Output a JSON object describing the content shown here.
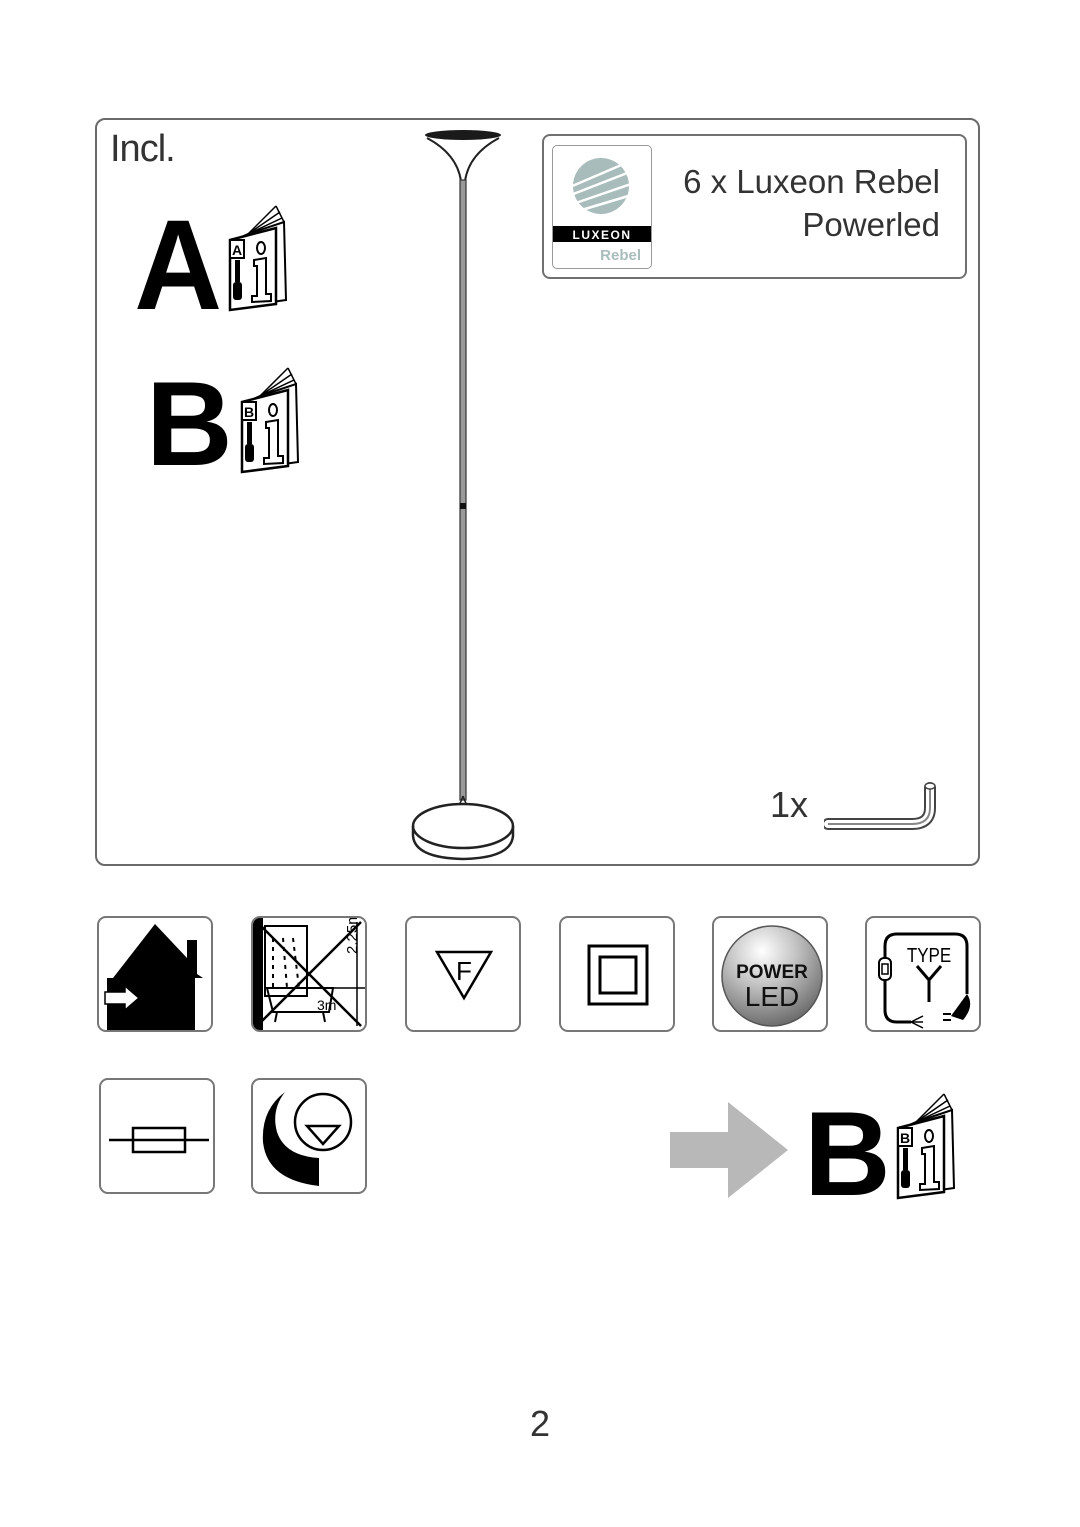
{
  "included_section": {
    "title": "Incl.",
    "manuals": [
      {
        "letter": "A",
        "icon": "manual-booklet-icon",
        "booklet_label": "A"
      },
      {
        "letter": "B",
        "icon": "manual-booklet-icon",
        "booklet_label": "B"
      }
    ],
    "product_illustration": "floor-lamp-uplighter",
    "led_info": {
      "logo_brand": "LUXEON",
      "logo_sub": "Rebel",
      "line1": "6 x Luxeon Rebel",
      "line2": "Powerled"
    },
    "accessory": {
      "quantity": "1x",
      "icon": "allen-key-icon"
    }
  },
  "symbols_row1": [
    {
      "name": "indoor-use-only-icon"
    },
    {
      "name": "no-bathroom-use-icon",
      "dim_height": "2.25m",
      "dim_distance": "3m"
    },
    {
      "name": "f-mark-icon",
      "label": "F"
    },
    {
      "name": "class-ii-double-insulation-icon"
    },
    {
      "name": "power-led-icon",
      "line1": "POWER",
      "line2": "LED"
    },
    {
      "name": "cable-type-y-icon",
      "label": "TYPE"
    }
  ],
  "symbols_row2": [
    {
      "name": "fuse-icon"
    },
    {
      "name": "lamp-replacement-icon"
    }
  ],
  "reference": {
    "arrow": "arrow-right-icon",
    "letter": "B",
    "booklet_label": "B"
  },
  "page_number": "2",
  "colors": {
    "border": "#6a6a6a",
    "luxeon_logo": "#a9bcbc",
    "arrow": "#b8b8b8",
    "text": "#333333"
  }
}
